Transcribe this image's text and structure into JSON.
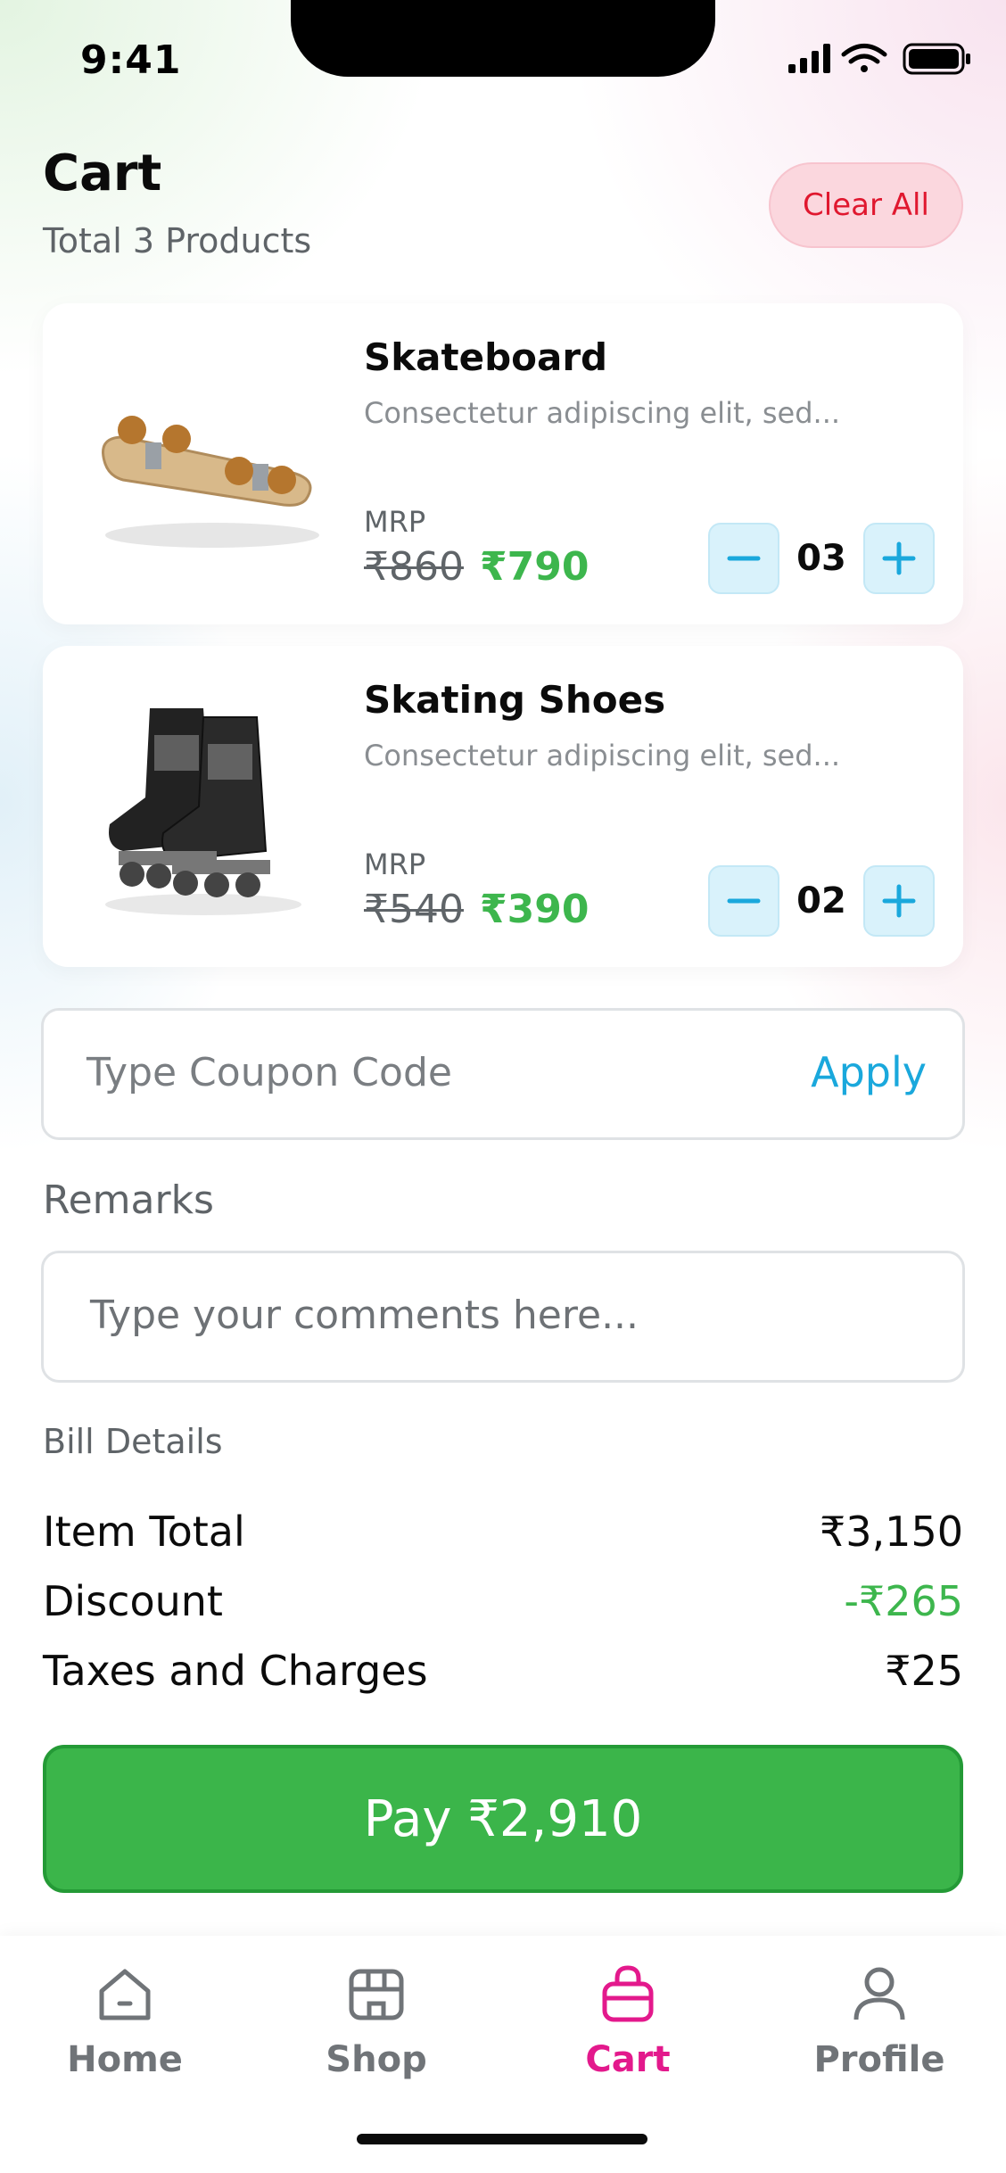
{
  "status_bar": {
    "time": "9:41"
  },
  "header": {
    "title": "Cart",
    "subtitle": "Total 3 Products",
    "clear_label": "Clear All"
  },
  "products": [
    {
      "name": "Skateboard",
      "description": "Consectetur adipiscing elit, sed...",
      "mrp_label": "MRP",
      "old_price": "₹860",
      "new_price": "₹790",
      "quantity": "03"
    },
    {
      "name": "Skating Shoes",
      "description": "Consectetur adipiscing elit, sed...",
      "mrp_label": "MRP",
      "old_price": "₹540",
      "new_price": "₹390",
      "quantity": "02"
    }
  ],
  "coupon": {
    "placeholder": "Type Coupon Code",
    "apply_label": "Apply"
  },
  "remarks": {
    "label": "Remarks",
    "placeholder": "Type your comments here..."
  },
  "bill": {
    "title": "Bill Details",
    "rows": [
      {
        "label": "Item Total",
        "value": "₹3,150"
      },
      {
        "label": "Discount",
        "value": "-₹265"
      },
      {
        "label": "Taxes and Charges",
        "value": "₹25"
      }
    ]
  },
  "pay_label": "Pay ₹2,910",
  "nav": {
    "items": [
      {
        "label": "Home",
        "icon": "home-icon"
      },
      {
        "label": "Shop",
        "icon": "shop-icon"
      },
      {
        "label": "Cart",
        "icon": "cart-bag-icon",
        "active": true
      },
      {
        "label": "Profile",
        "icon": "profile-icon"
      }
    ]
  },
  "colors": {
    "accent_green": "#3bb54a",
    "accent_blue": "#1aa8dc",
    "accent_pink": "#e3198c",
    "danger_red": "#e0182f"
  }
}
